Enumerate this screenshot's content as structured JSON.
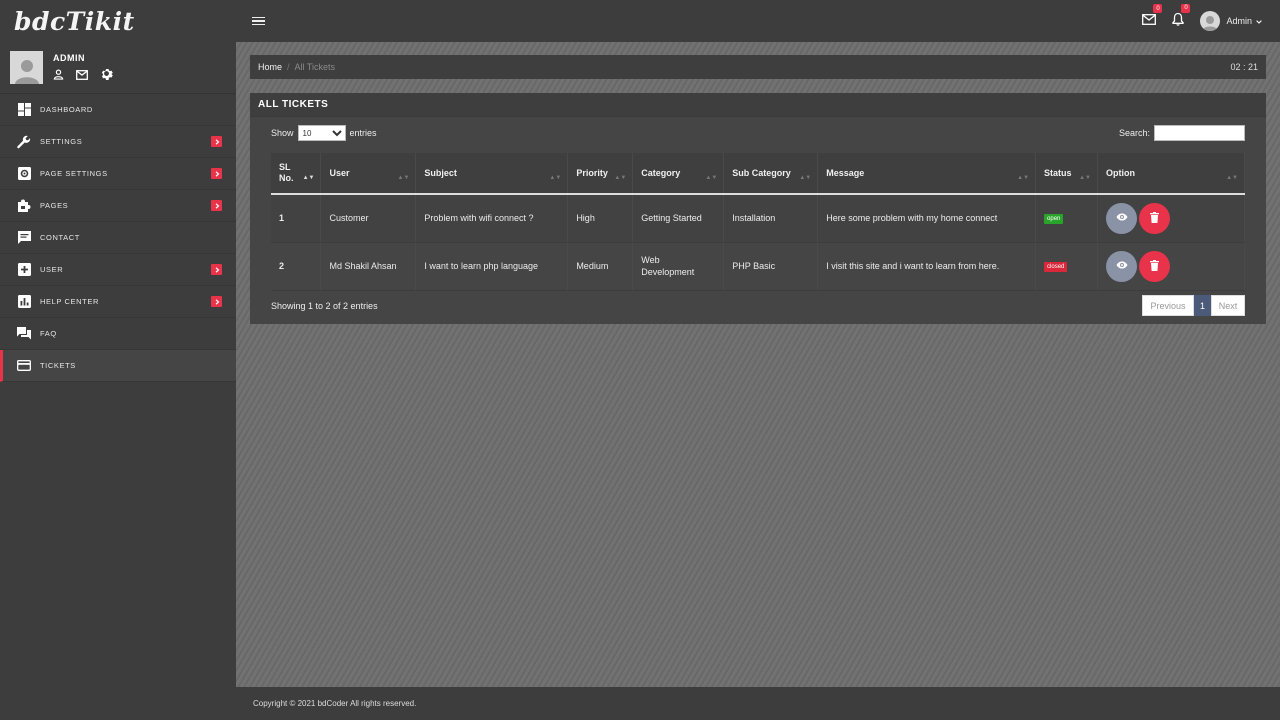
{
  "app": {
    "logo": "bdcTikit"
  },
  "profile": {
    "name": "ADMIN"
  },
  "sidebar": {
    "items": [
      {
        "label": "DASHBOARD",
        "icon": "dashboard-icon",
        "arrow": false
      },
      {
        "label": "SETTINGS",
        "icon": "wrench-icon",
        "arrow": true
      },
      {
        "label": "PAGE SETTINGS",
        "icon": "cog-box-icon",
        "arrow": true
      },
      {
        "label": "PAGES",
        "icon": "puzzle-icon",
        "arrow": true
      },
      {
        "label": "CONTACT",
        "icon": "chat-icon",
        "arrow": false
      },
      {
        "label": "USER",
        "icon": "plus-box-icon",
        "arrow": true
      },
      {
        "label": "HELP CENTER",
        "icon": "bar-chart-icon",
        "arrow": true
      },
      {
        "label": "FAQ",
        "icon": "forum-icon",
        "arrow": false
      },
      {
        "label": "TICKETS",
        "icon": "credit-card-icon",
        "arrow": false,
        "active": true
      }
    ]
  },
  "topbar": {
    "mail_count": "0",
    "notif_count": "0",
    "user": "Admin"
  },
  "breadcrumb": {
    "home": "Home",
    "sep": "/",
    "current": "All Tickets",
    "clock": "02 : 21"
  },
  "panel": {
    "title": "ALL TICKETS",
    "show_label": "Show",
    "entries_label": "entries",
    "page_size": "10",
    "search_label": "Search:",
    "search_value": ""
  },
  "table": {
    "headers": [
      "SL No.",
      "User",
      "Subject",
      "Priority",
      "Category",
      "Sub Category",
      "Message",
      "Status",
      "Option"
    ],
    "rows": [
      {
        "sl": "1",
        "user": "Customer",
        "subject": "Problem with wifi connect ?",
        "priority": "High",
        "category": "Getting Started",
        "subcategory": "Installation",
        "message": "Here some problem with my home connect",
        "status": "open"
      },
      {
        "sl": "2",
        "user": "Md Shakil Ahsan",
        "subject": "I want to learn php language",
        "priority": "Medium",
        "category": "Web Development",
        "subcategory": "PHP Basic",
        "message": "I visit this site and i want to learn from here.",
        "status": "closed"
      }
    ]
  },
  "table_footer": {
    "info": "Showing 1 to 2 of 2 entries",
    "prev": "Previous",
    "page": "1",
    "next": "Next"
  },
  "footer": {
    "copyright": "Copyright © 2021 bdCoder All rights reserved."
  },
  "colors": {
    "accent": "#e8334a",
    "open": "#2aa32a",
    "closed": "#d9283a",
    "view_button": "#8a93a6",
    "pager_active": "#4b5a78"
  }
}
